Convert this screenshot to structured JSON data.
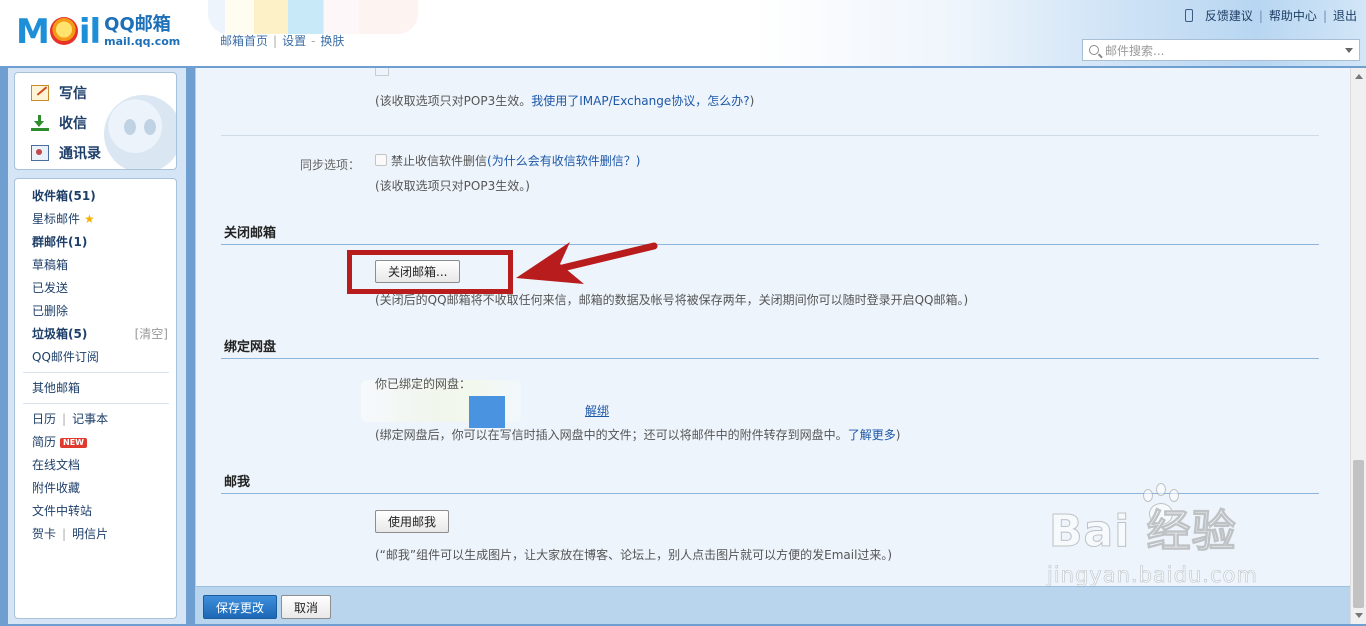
{
  "header": {
    "logo_mail": "M",
    "logo_mail_rest": "il",
    "logo_title": "QQ邮箱",
    "logo_sub": "mail.qq.com",
    "links": [
      "邮箱首页",
      "设置",
      "换肤"
    ],
    "link_seps": [
      "|",
      "-"
    ],
    "right_links": [
      "反馈建议",
      "帮助中心",
      "退出"
    ],
    "right_sep": "|",
    "search_placeholder": "邮件搜索..."
  },
  "sidebar": {
    "top": [
      {
        "label": "写信",
        "icon": "write-icon"
      },
      {
        "label": "收信",
        "icon": "inbox-download-icon"
      },
      {
        "label": "通讯录",
        "icon": "contacts-icon"
      }
    ],
    "folders": {
      "inbox": "收件箱",
      "inbox_count": "(51)",
      "starred": "星标邮件",
      "group": "群邮件",
      "group_count": "(1)",
      "drafts": "草稿箱",
      "sent": "已发送",
      "deleted": "已删除",
      "spam": "垃圾箱",
      "spam_count": "(5)",
      "spam_clear": "[清空]",
      "subscribe": "QQ邮件订阅",
      "other": "其他邮箱",
      "calendar": "日历",
      "notes": "记事本",
      "resume": "简历",
      "resume_tag": "NEW",
      "docs": "在线文档",
      "attach": "附件收藏",
      "transfer": "文件中转站",
      "card": "贺卡",
      "postcard": "明信片",
      "sep": "|"
    }
  },
  "content": {
    "pop3_note_a": "(该收取选项只对POP3生效。",
    "pop3_note_link": "我使用了IMAP/Exchange协议，怎么办?",
    "pop3_note_b": ")",
    "sync_label": "同步选项：",
    "sync_checkbox": "禁止收信软件删信",
    "sync_link": "(为什么会有收信软件删信？)",
    "pop3_note2": "(该收取选项只对POP3生效。)",
    "close_section": "关闭邮箱",
    "close_button": "关闭邮箱...",
    "close_note": "(关闭后的QQ邮箱将不收取任何来信，邮箱的数据及帐号将被保存两年，关闭期间你可以随时登录开启QQ邮箱。)",
    "bind_section": "绑定网盘",
    "bind_label": "你已绑定的网盘：",
    "unbind_link": "解绑",
    "bind_note_a": "(绑定网盘后，你可以在写信时插入网盘中的文件；还可以将邮件中的附件转存到网盘中。",
    "bind_note_link": "了解更多",
    "bind_note_b": ")",
    "mailme_section": "邮我",
    "mailme_button": "使用邮我",
    "mailme_note": "(“邮我”组件可以生成图片，让大家放在博客、论坛上，别人点击图片就可以方便的发Email过来。)"
  },
  "footer": {
    "save": "保存更改",
    "cancel": "取消"
  },
  "watermark": {
    "main": "Bai 经验",
    "sub": "jingyan.baidu.com"
  },
  "colors": {
    "brand_blue": "#1d8fd8",
    "highlight_red": "#b81c1c",
    "save_blue": "#1d68b6",
    "link_blue": "#1d57a8"
  }
}
